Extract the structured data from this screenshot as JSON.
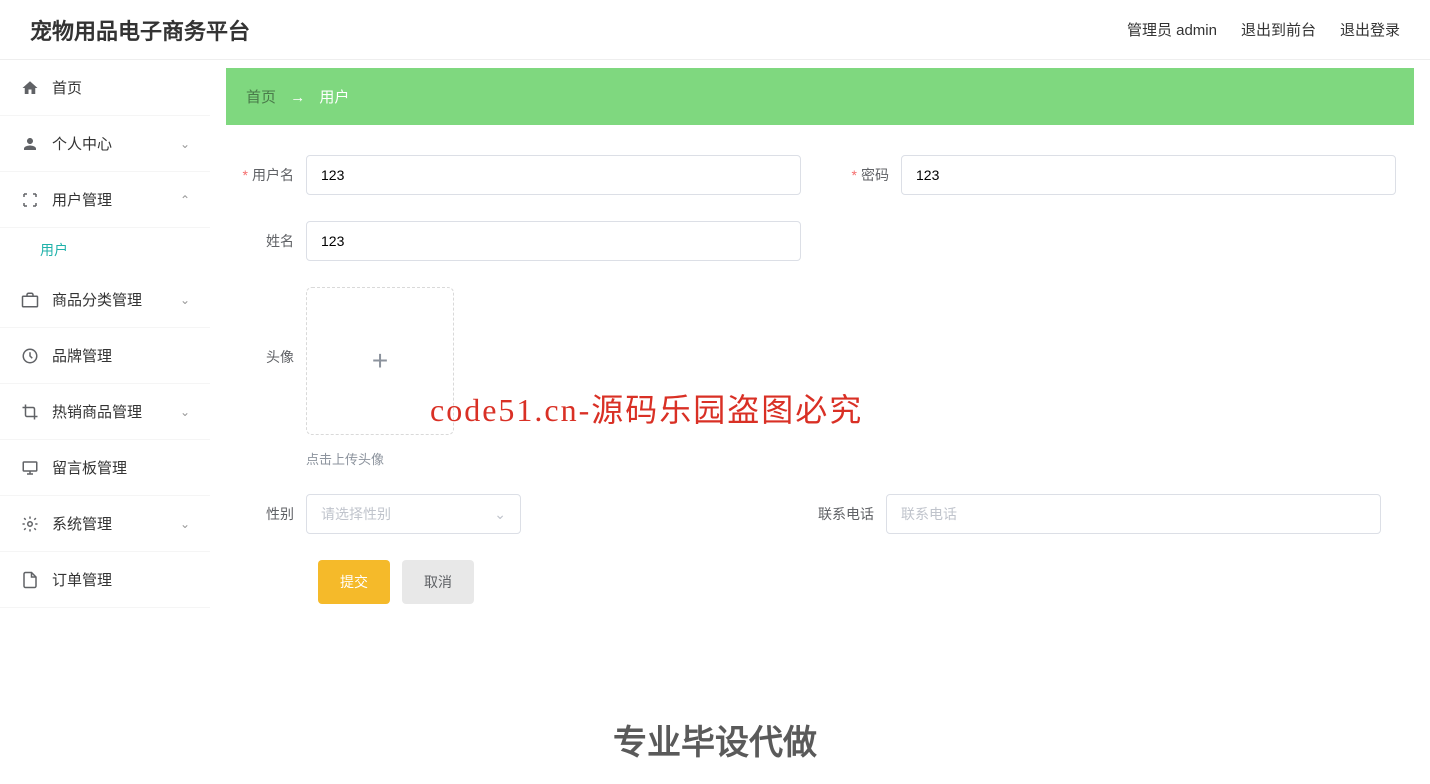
{
  "header": {
    "title": "宠物用品电子商务平台",
    "admin": "管理员 admin",
    "to_front": "退出到前台",
    "logout": "退出登录"
  },
  "sidebar": {
    "home": "首页",
    "profile": "个人中心",
    "user_mgmt": "用户管理",
    "user_sub": "用户",
    "category": "商品分类管理",
    "brand": "品牌管理",
    "hot": "热销商品管理",
    "message": "留言板管理",
    "system": "系统管理",
    "order": "订单管理"
  },
  "breadcrumb": {
    "home": "首页",
    "arrow": "→",
    "current": "用户"
  },
  "form": {
    "username_label": "用户名",
    "username_value": "123",
    "password_label": "密码",
    "password_value": "123",
    "name_label": "姓名",
    "name_value": "123",
    "avatar_label": "头像",
    "avatar_hint": "点击上传头像",
    "gender_label": "性别",
    "gender_placeholder": "请选择性别",
    "phone_label": "联系电话",
    "phone_placeholder": "联系电话",
    "submit": "提交",
    "cancel": "取消"
  },
  "watermark": "code51.cn",
  "watermark_red": "code51.cn-源码乐园盗图必究",
  "footer": "专业毕设代做"
}
